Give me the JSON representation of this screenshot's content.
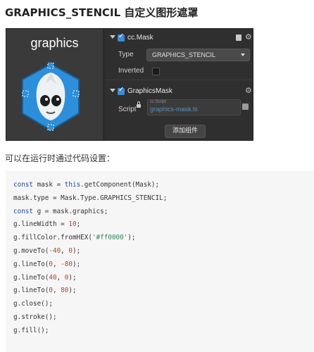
{
  "heading": "GRAPHICS_STENCIL 自定义图形遮罩",
  "preview": {
    "label": "graphics"
  },
  "inspector": {
    "mask_component": {
      "name": "cc.Mask",
      "enabled": true
    },
    "type_label": "Type",
    "type_value": "GRAPHICS_STENCIL",
    "inverted_label": "Inverted",
    "inverted": false,
    "graphics_component": {
      "name": "GraphicsMask",
      "enabled": true
    },
    "script_label": "Script",
    "script_tag": "cc.Script",
    "script_value": "graphics-mask.ts",
    "add_component": "添加组件"
  },
  "paragraph": "可以在运行时通过代码设置：",
  "code": {
    "lines": [
      [
        {
          "t": "const",
          "c": "kw"
        },
        {
          "t": " mask = "
        },
        {
          "t": "this",
          "c": "kw"
        },
        {
          "t": ".getComponent(Mask);"
        }
      ],
      [
        {
          "t": "mask.type = Mask.Type.GRAPHICS_STENCIL;"
        }
      ],
      [
        {
          "t": "const",
          "c": "kw"
        },
        {
          "t": " g = mask.graphics;"
        }
      ],
      [
        {
          "t": "g.lineWidth = "
        },
        {
          "t": "10",
          "c": "num"
        },
        {
          "t": ";"
        }
      ],
      [
        {
          "t": "g.fillColor.fromHEX("
        },
        {
          "t": "'#ff0000'",
          "c": "str"
        },
        {
          "t": ");"
        }
      ],
      [
        {
          "t": "g.moveTo("
        },
        {
          "t": "-40",
          "c": "num"
        },
        {
          "t": ", "
        },
        {
          "t": "0",
          "c": "num"
        },
        {
          "t": ");"
        }
      ],
      [
        {
          "t": "g.lineTo("
        },
        {
          "t": "0",
          "c": "num"
        },
        {
          "t": ", "
        },
        {
          "t": "-80",
          "c": "num"
        },
        {
          "t": ");"
        }
      ],
      [
        {
          "t": "g.lineTo("
        },
        {
          "t": "40",
          "c": "num"
        },
        {
          "t": ", "
        },
        {
          "t": "0",
          "c": "num"
        },
        {
          "t": ");"
        }
      ],
      [
        {
          "t": "g.lineTo("
        },
        {
          "t": "0",
          "c": "num"
        },
        {
          "t": ", "
        },
        {
          "t": "80",
          "c": "num"
        },
        {
          "t": ");"
        }
      ],
      [
        {
          "t": "g.close();"
        }
      ],
      [
        {
          "t": "g.stroke();"
        }
      ],
      [
        {
          "t": "g.fill();"
        }
      ]
    ]
  },
  "icons": {
    "collapse": "triangle-down-icon",
    "checkbox": "checkbox-icon",
    "help": "book-icon",
    "settings": "gear-icon",
    "lock": "lock-icon",
    "picker": "asset-picker-icon",
    "logo": "cocos-logo-icon"
  },
  "colors": {
    "accent": "#3d8cd4",
    "panel": "#2f2f2f",
    "code_bg": "#f6f6f6",
    "keyword": "#1f4aa0",
    "number": "#b4432b",
    "string": "#2e8b57"
  }
}
